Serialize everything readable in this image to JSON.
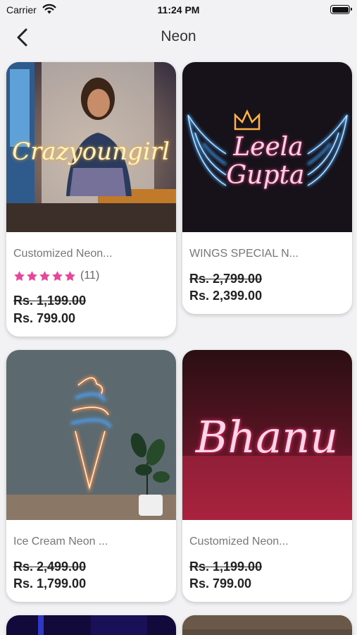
{
  "status_bar": {
    "carrier": "Carrier",
    "time": "11:24 PM"
  },
  "nav": {
    "title": "Neon"
  },
  "products": [
    {
      "name": "Customized Neon...",
      "rating_count": "(11)",
      "stars": 5,
      "old_price": "Rs. 1,199.00",
      "new_price": "Rs. 799.00",
      "image": "crazyoungirl-sign",
      "image_text": "Crazyoungirl"
    },
    {
      "name": "WINGS SPECIAL N...",
      "old_price": "Rs. 2,799.00",
      "new_price": "Rs. 2,399.00",
      "image": "wings-sign",
      "image_text_line1": "Leela",
      "image_text_line2": "Gupta"
    },
    {
      "name": "Ice Cream Neon ...",
      "old_price": "Rs. 2,499.00",
      "new_price": "Rs. 1,799.00",
      "image": "ice-cream-sign"
    },
    {
      "name": "Customized Neon...",
      "old_price": "Rs. 1,199.00",
      "new_price": "Rs. 799.00",
      "image": "bhanu-sign",
      "image_text": "Bhanu"
    }
  ],
  "colors": {
    "star": "#e5489a",
    "background": "#f2f2f4"
  }
}
